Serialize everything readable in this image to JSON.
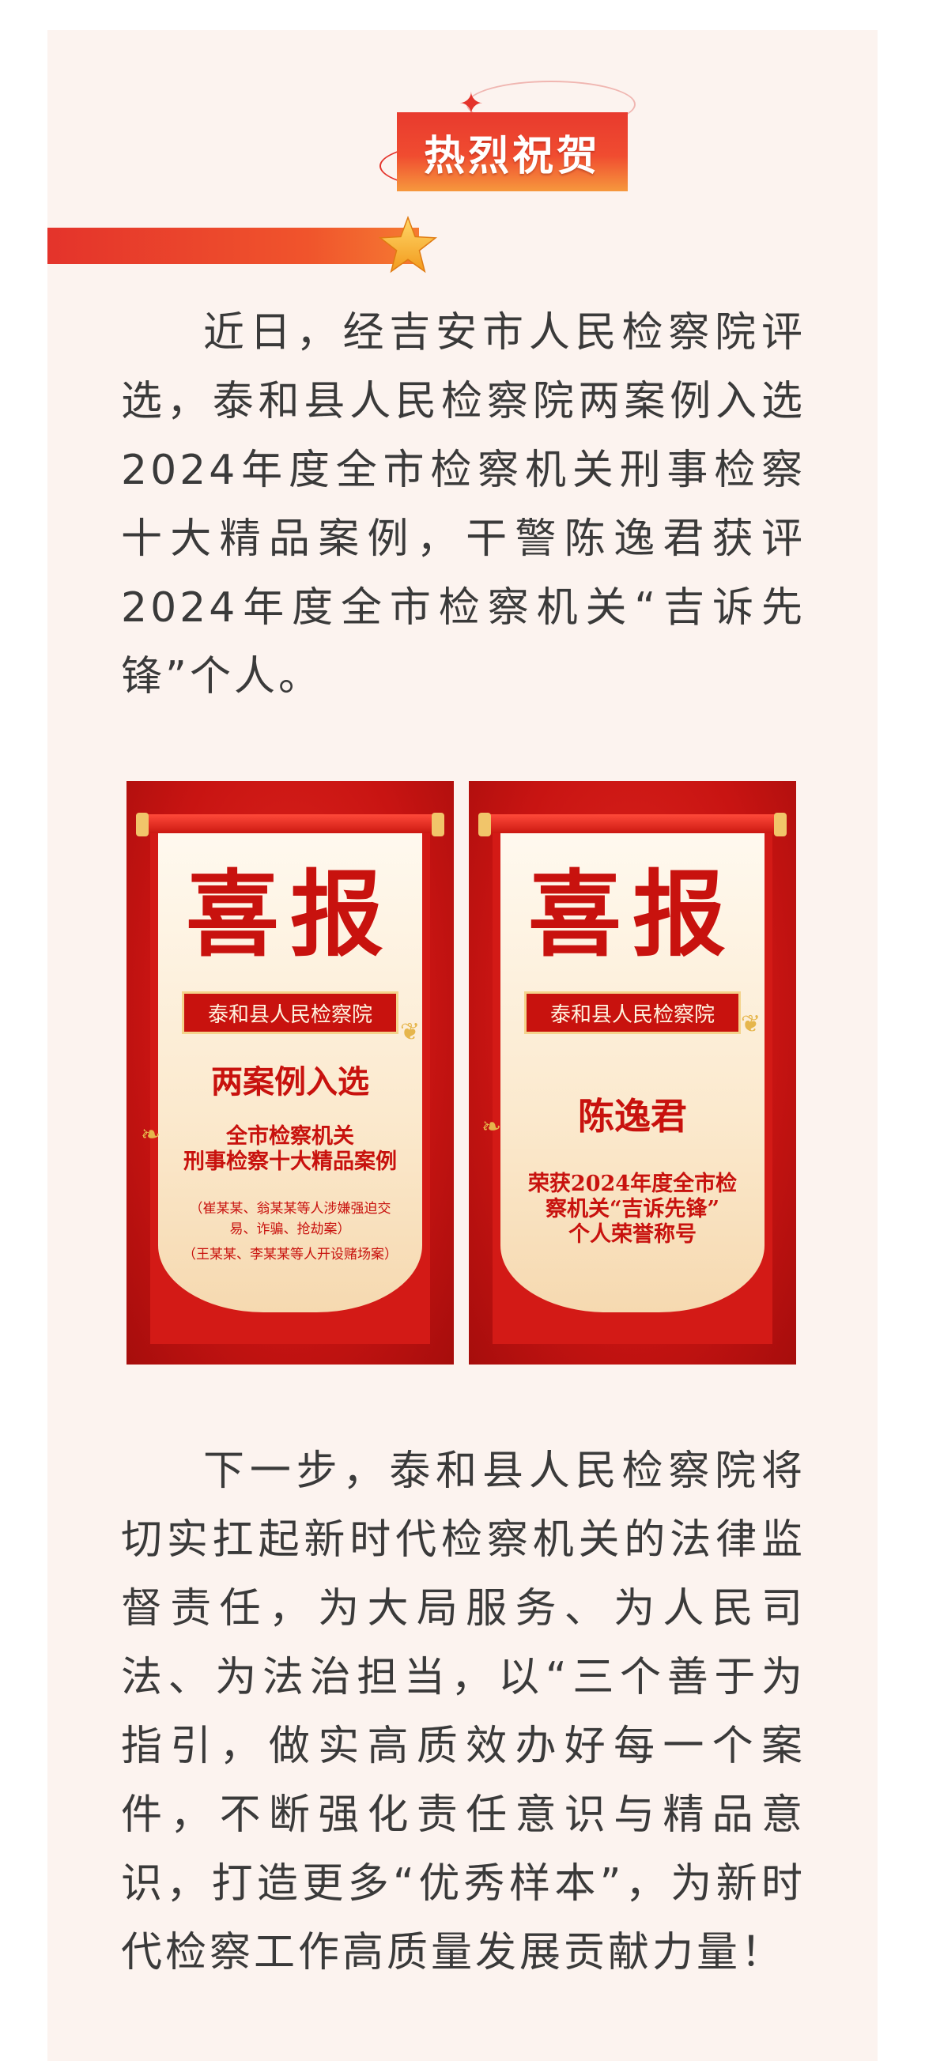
{
  "header": {
    "badge_text": "热烈祝贺"
  },
  "paragraphs": {
    "p1": "近日，经吉安市人民检察院评选，泰和县人民检察院两案例入选2024年度全市检察机关刑事检察十大精品案例，干警陈逸君获评2024年度全市检察机关“吉诉先锋”个人。",
    "p2": "下一步，泰和县人民检察院将切实扛起新时代检察机关的法律监督责任，为大局服务、为人民司法、为法治担当，以“三个善于为指引，做实高质效办好每一个案件，不断强化责任意识与精品意识，打造更多“优秀样本”，为新时代检察工作高质量发展贡献力量！"
  },
  "posters": {
    "left": {
      "title": "喜报",
      "org": "泰和县人民检察院",
      "headline": "两案例入选",
      "sub_line1": "全市检察机关",
      "sub_line2": "刑事检察十大精品案例",
      "note_line1": "（崔某某、翁某某等人涉嫌强迫交",
      "note_line2": "易、诈骗、抢劫案）",
      "note_line3": "（王某某、李某某等人开设赌场案）"
    },
    "right": {
      "title": "喜报",
      "org": "泰和县人民检察院",
      "headline": "陈逸君",
      "sub_line1": "荣获2024年度全市检",
      "sub_line2": "察机关“吉诉先锋”",
      "sub_line3": "个人荣誉称号"
    }
  },
  "colors": {
    "accent_red": "#e4332b",
    "poster_red": "#c8120e",
    "card_bg": "#fcf3ef",
    "body_text": "#3a3a3a"
  }
}
